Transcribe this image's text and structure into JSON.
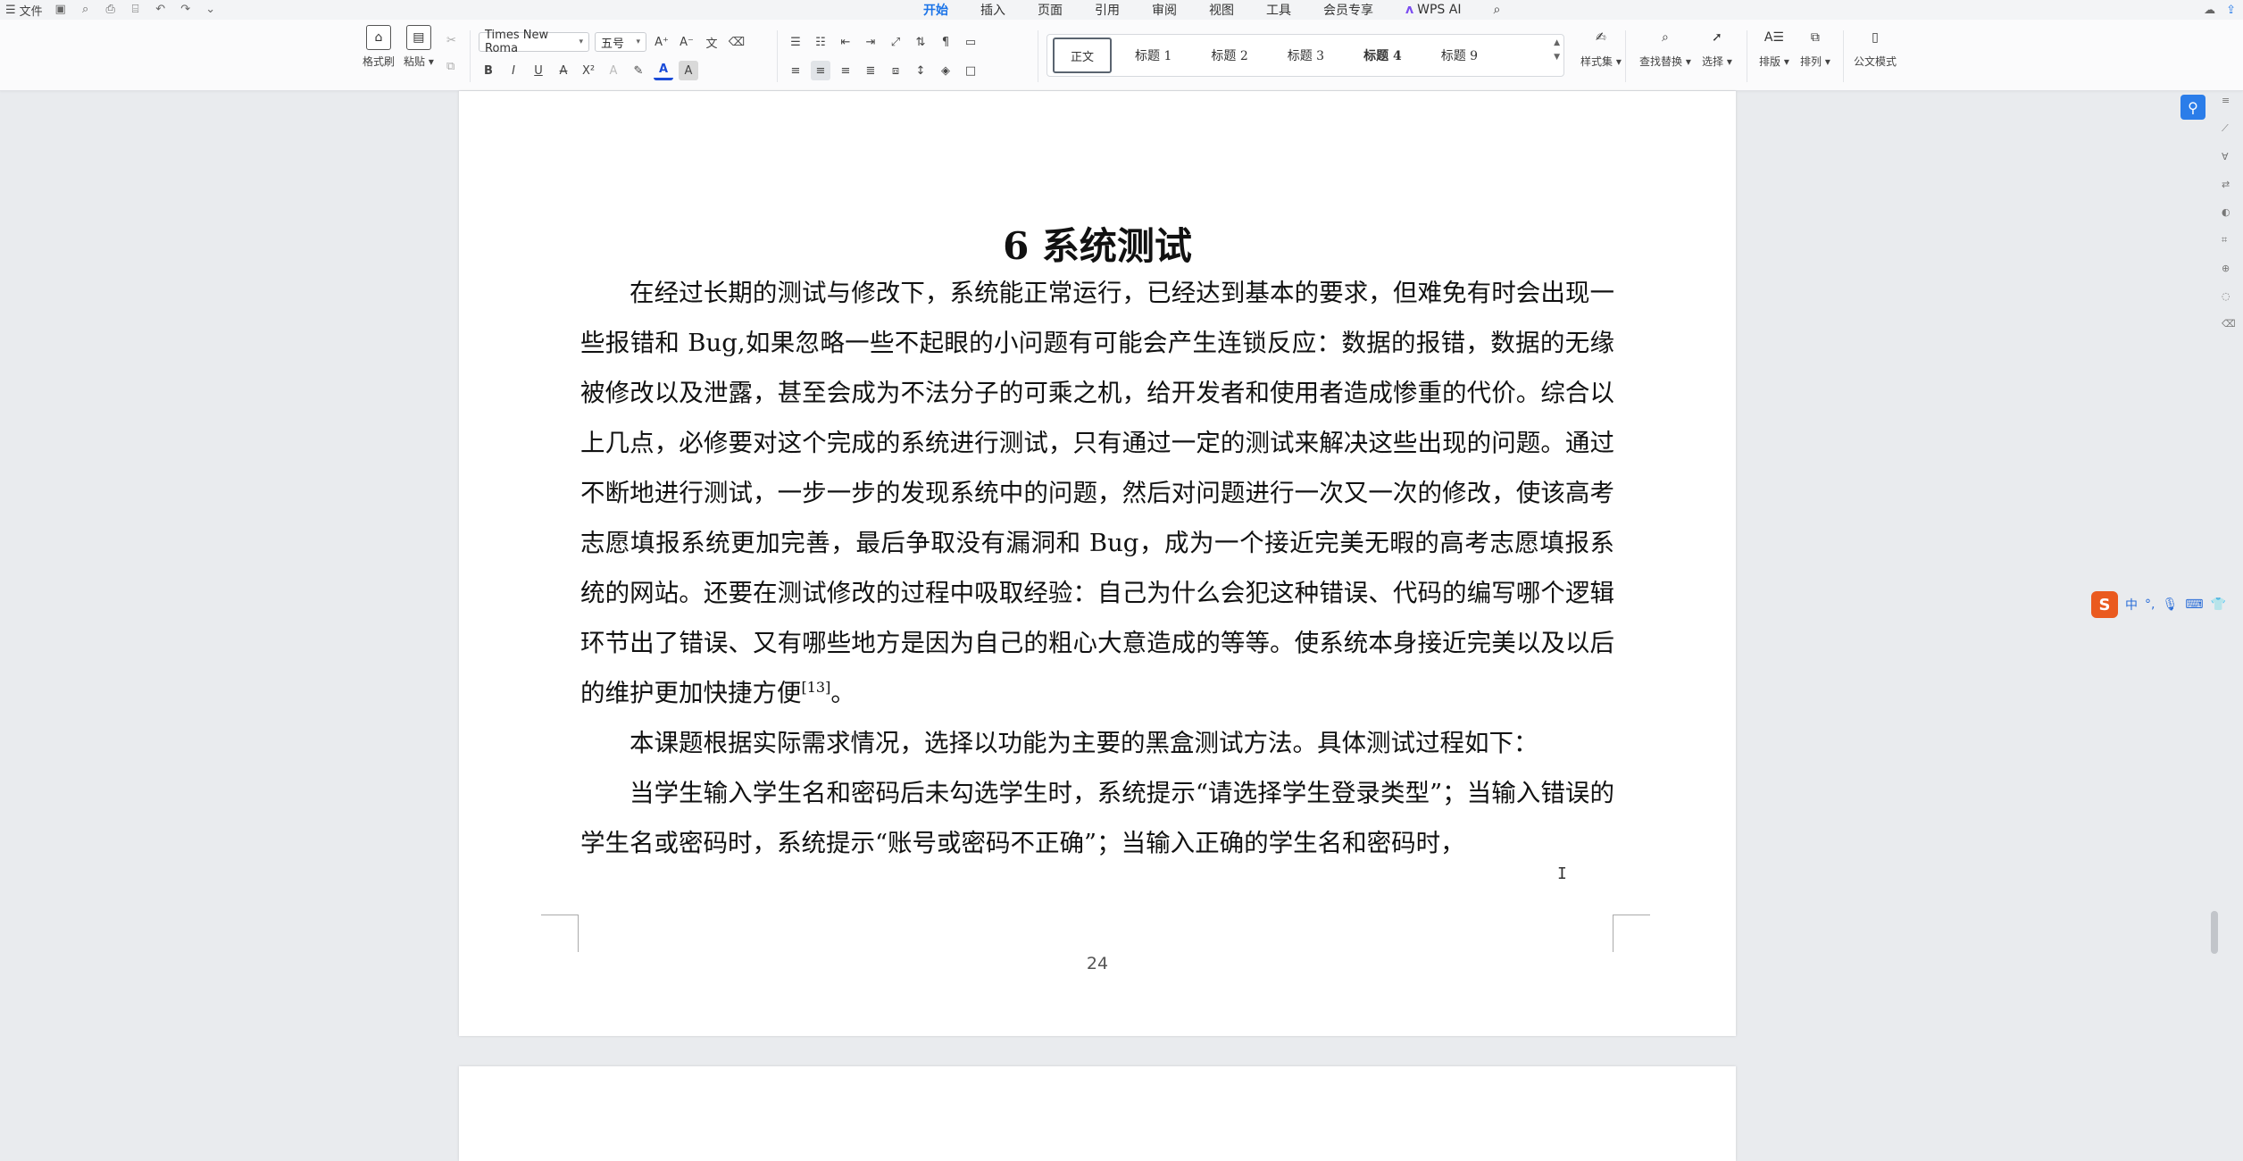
{
  "titlebar": {
    "file_menu": "文件",
    "tabs": [
      "开始",
      "插入",
      "页面",
      "引用",
      "审阅",
      "视图",
      "工具",
      "会员专享"
    ],
    "active_tab": "开始",
    "wps_ai": "WPS AI"
  },
  "ribbon": {
    "format_painter": "格式刷",
    "paste": "粘贴",
    "font_name": "Times New Roma",
    "font_size": "五号",
    "styles": [
      "正文",
      "标题 1",
      "标题 2",
      "标题 3",
      "标题 4",
      "标题 9"
    ],
    "style_set": "样式集",
    "find_replace": "查找替换",
    "select": "选择",
    "layout": "排版",
    "arrange": "排列",
    "official_doc": "公文模式"
  },
  "document": {
    "heading": "6 系统测试",
    "paragraph1": "在经过长期的测试与修改下，系统能正常运行，已经达到基本的要求，但难免有时会出现一些报错和 Bug,如果忽略一些不起眼的小问题有可能会产生连锁反应：数据的报错，数据的无缘被修改以及泄露，甚至会成为不法分子的可乘之机，给开发者和使用者造成惨重的代价。综合以上几点，必修要对这个完成的系统进行测试，只有通过一定的测试来解决这些出现的问题。通过不断地进行测试，一步一步的发现系统中的问题，然后对问题进行一次又一次的修改，使该高考志愿填报系统更加完善，最后争取没有漏洞和 Bug，成为一个接近完美无暇的高考志愿填报系统的网站。还要在测试修改的过程中吸取经验：自己为什么会犯这种错误、代码的编写哪个逻辑环节出了错误、又有哪些地方是因为自己的粗心大意造成的等等。使系统本身接近完美以及以后的维护更加快捷方便",
    "citation": "[13]",
    "paragraph1_end": "。",
    "paragraph2": "本课题根据实际需求情况，选择以功能为主要的黑盒测试方法。具体测试过程如下：",
    "paragraph3": "当学生输入学生名和密码后未勾选学生时，系统提示“请选择学生登录类型”；当输入错误的学生名或密码时，系统提示“账号或密码不正确”；当输入正确的学生名和密码时，",
    "page_number": "24"
  },
  "ime": {
    "logo": "S",
    "mode": "中"
  },
  "colors": {
    "accent": "#1a73e8",
    "page_bg": "#e9ebee",
    "ime_orange": "#ea5a1f"
  }
}
